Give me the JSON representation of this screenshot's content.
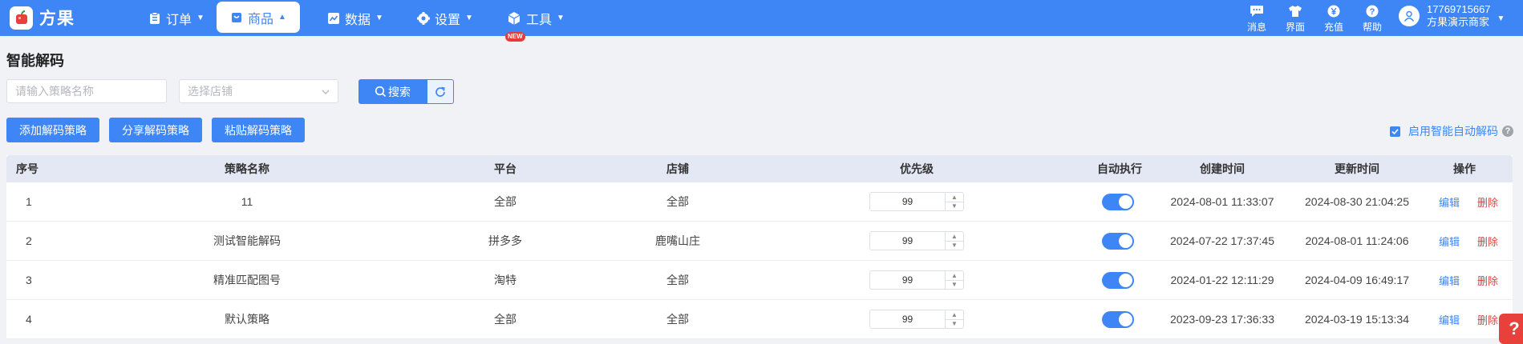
{
  "app": {
    "name": "方果"
  },
  "nav": {
    "items": [
      {
        "label": "订单",
        "icon": "clipboard-icon"
      },
      {
        "label": "商品",
        "icon": "shopping-bag-icon",
        "active": true
      },
      {
        "label": "数据",
        "icon": "line-chart-icon"
      },
      {
        "label": "设置",
        "icon": "gear-icon"
      },
      {
        "label": "工具",
        "icon": "toolbox-icon",
        "badge": "NEW"
      }
    ]
  },
  "toolbar": {
    "items": [
      {
        "label": "消息",
        "icon": "chat-icon"
      },
      {
        "label": "界面",
        "icon": "shirt-icon"
      },
      {
        "label": "充值",
        "icon": "yen-coin-icon"
      },
      {
        "label": "帮助",
        "icon": "question-icon"
      }
    ]
  },
  "user": {
    "phone": "17769715667",
    "name": "方果演示商家"
  },
  "page": {
    "title": "智能解码"
  },
  "filters": {
    "name_placeholder": "请输入策略名称",
    "store_placeholder": "选择店铺",
    "search_label": "搜索"
  },
  "actions": {
    "add": "添加解码策略",
    "share": "分享解码策略",
    "paste": "粘贴解码策略"
  },
  "auto_decode": {
    "label": "启用智能自动解码",
    "checked": true
  },
  "table": {
    "headers": [
      "序号",
      "策略名称",
      "平台",
      "店铺",
      "优先级",
      "自动执行",
      "创建时间",
      "更新时间",
      "操作"
    ],
    "rows": [
      {
        "no": "1",
        "name": "11",
        "platform": "全部",
        "store": "全部",
        "priority": "99",
        "auto": true,
        "created": "2024-08-01 11:33:07",
        "updated": "2024-08-30 21:04:25"
      },
      {
        "no": "2",
        "name": "测试智能解码",
        "platform": "拼多多",
        "store": "鹿嘴山庄",
        "priority": "99",
        "auto": true,
        "created": "2024-07-22 17:37:45",
        "updated": "2024-08-01 11:24:06"
      },
      {
        "no": "3",
        "name": "精准匹配图号",
        "platform": "淘特",
        "store": "全部",
        "priority": "99",
        "auto": true,
        "created": "2024-01-22 12:11:29",
        "updated": "2024-04-09 16:49:17"
      },
      {
        "no": "4",
        "name": "默认策略",
        "platform": "全部",
        "store": "全部",
        "priority": "99",
        "auto": true,
        "created": "2023-09-23 17:36:33",
        "updated": "2024-03-19 15:13:34"
      }
    ],
    "edit_label": "编辑",
    "delete_label": "删除"
  },
  "colors": {
    "brand": "#3e86f5",
    "danger": "#e8403a",
    "header_bg": "#e4e8f4"
  }
}
